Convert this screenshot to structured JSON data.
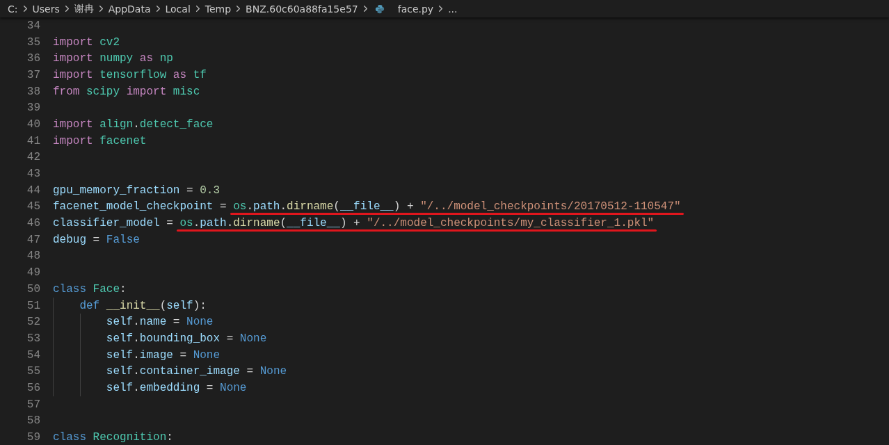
{
  "breadcrumb": [
    {
      "label": "C:",
      "kind": "folder"
    },
    {
      "label": "Users",
      "kind": "folder"
    },
    {
      "label": "谢冉",
      "kind": "folder"
    },
    {
      "label": "AppData",
      "kind": "folder"
    },
    {
      "label": "Local",
      "kind": "folder"
    },
    {
      "label": "Temp",
      "kind": "folder"
    },
    {
      "label": "BNZ.60c60a88fa15e57",
      "kind": "folder"
    },
    {
      "label": "face.py",
      "kind": "python-file"
    },
    {
      "label": "...",
      "kind": "more"
    }
  ],
  "editor": {
    "lines": [
      {
        "number": "34"
      },
      {
        "number": "35",
        "tokens": [
          {
            "text": "import",
            "kind": "keyword"
          },
          {
            "text": " cv2",
            "kind": "module"
          }
        ]
      },
      {
        "number": "36",
        "tokens": [
          {
            "text": "import",
            "kind": "keyword"
          },
          {
            "text": " numpy ",
            "kind": "module"
          },
          {
            "text": "as",
            "kind": "keyword"
          },
          {
            "text": " np",
            "kind": "module"
          }
        ]
      },
      {
        "number": "37",
        "tokens": [
          {
            "text": "import",
            "kind": "keyword"
          },
          {
            "text": " tensorflow ",
            "kind": "module"
          },
          {
            "text": "as",
            "kind": "keyword"
          },
          {
            "text": " tf",
            "kind": "module"
          }
        ]
      },
      {
        "number": "38",
        "tokens": [
          {
            "text": "from",
            "kind": "keyword"
          },
          {
            "text": " scipy ",
            "kind": "module"
          },
          {
            "text": "import",
            "kind": "keyword"
          },
          {
            "text": " misc",
            "kind": "module"
          }
        ]
      },
      {
        "number": "39"
      },
      {
        "number": "40",
        "tokens": [
          {
            "text": "import",
            "kind": "keyword"
          },
          {
            "text": " align",
            "kind": "module"
          },
          {
            "text": ".",
            "kind": "operator"
          },
          {
            "text": "detect_face",
            "kind": "module"
          }
        ]
      },
      {
        "number": "41",
        "tokens": [
          {
            "text": "import",
            "kind": "keyword"
          },
          {
            "text": " facenet",
            "kind": "module"
          }
        ]
      },
      {
        "number": "42"
      },
      {
        "number": "43"
      },
      {
        "number": "44",
        "tokens": [
          {
            "text": "gpu_memory_fraction",
            "kind": "variable"
          },
          {
            "text": " = ",
            "kind": "operator"
          },
          {
            "text": "0.3",
            "kind": "number"
          }
        ]
      },
      {
        "number": "45",
        "tokens": [
          {
            "text": "facenet_model_checkpoint",
            "kind": "variable"
          },
          {
            "text": " = ",
            "kind": "operator"
          }
        ],
        "underlined": [
          {
            "text": "os",
            "kind": "module"
          },
          {
            "text": ".",
            "kind": "operator"
          },
          {
            "text": "path",
            "kind": "variable"
          },
          {
            "text": ".",
            "kind": "operator"
          },
          {
            "text": "dirname",
            "kind": "function"
          },
          {
            "text": "(",
            "kind": "operator"
          },
          {
            "text": "__file__",
            "kind": "variable"
          },
          {
            "text": ") + ",
            "kind": "operator"
          },
          {
            "text": "\"/../model_checkpoints/20170512-110547\"",
            "kind": "string"
          }
        ]
      },
      {
        "number": "46",
        "tokens": [
          {
            "text": "classifier_model",
            "kind": "variable"
          },
          {
            "text": " = ",
            "kind": "operator"
          }
        ],
        "underlined": [
          {
            "text": "os",
            "kind": "module"
          },
          {
            "text": ".",
            "kind": "operator"
          },
          {
            "text": "path",
            "kind": "variable"
          },
          {
            "text": ".",
            "kind": "operator"
          },
          {
            "text": "dirname",
            "kind": "function"
          },
          {
            "text": "(",
            "kind": "operator"
          },
          {
            "text": "__file__",
            "kind": "variable"
          },
          {
            "text": ") + ",
            "kind": "operator"
          },
          {
            "text": "\"/../model_checkpoints/my_classifier_1.pkl\"",
            "kind": "string"
          }
        ]
      },
      {
        "number": "47",
        "tokens": [
          {
            "text": "debug",
            "kind": "variable"
          },
          {
            "text": " = ",
            "kind": "operator"
          },
          {
            "text": "False",
            "kind": "constant"
          }
        ]
      },
      {
        "number": "48"
      },
      {
        "number": "49"
      },
      {
        "number": "50",
        "tokens": [
          {
            "text": "class",
            "kind": "storage"
          },
          {
            "text": " Face",
            "kind": "module"
          },
          {
            "text": ":",
            "kind": "operator"
          }
        ]
      },
      {
        "number": "51",
        "tokens": [
          {
            "text": "    def",
            "kind": "storage"
          },
          {
            "text": " __init__",
            "kind": "function"
          },
          {
            "text": "(",
            "kind": "operator"
          },
          {
            "text": "self",
            "kind": "variable"
          },
          {
            "text": "):",
            "kind": "operator"
          }
        ]
      },
      {
        "number": "52",
        "tokens": [
          {
            "text": "        self",
            "kind": "variable"
          },
          {
            "text": ".",
            "kind": "operator"
          },
          {
            "text": "name",
            "kind": "variable"
          },
          {
            "text": " = ",
            "kind": "operator"
          },
          {
            "text": "None",
            "kind": "constant"
          }
        ]
      },
      {
        "number": "53",
        "tokens": [
          {
            "text": "        self",
            "kind": "variable"
          },
          {
            "text": ".",
            "kind": "operator"
          },
          {
            "text": "bounding_box",
            "kind": "variable"
          },
          {
            "text": " = ",
            "kind": "operator"
          },
          {
            "text": "None",
            "kind": "constant"
          }
        ]
      },
      {
        "number": "54",
        "tokens": [
          {
            "text": "        self",
            "kind": "variable"
          },
          {
            "text": ".",
            "kind": "operator"
          },
          {
            "text": "image",
            "kind": "variable"
          },
          {
            "text": " = ",
            "kind": "operator"
          },
          {
            "text": "None",
            "kind": "constant"
          }
        ]
      },
      {
        "number": "55",
        "tokens": [
          {
            "text": "        self",
            "kind": "variable"
          },
          {
            "text": ".",
            "kind": "operator"
          },
          {
            "text": "container_image",
            "kind": "variable"
          },
          {
            "text": " = ",
            "kind": "operator"
          },
          {
            "text": "None",
            "kind": "constant"
          }
        ]
      },
      {
        "number": "56",
        "tokens": [
          {
            "text": "        self",
            "kind": "variable"
          },
          {
            "text": ".",
            "kind": "operator"
          },
          {
            "text": "embedding",
            "kind": "variable"
          },
          {
            "text": " = ",
            "kind": "operator"
          },
          {
            "text": "None",
            "kind": "constant"
          }
        ]
      },
      {
        "number": "57"
      },
      {
        "number": "58"
      },
      {
        "number": "59",
        "tokens": [
          {
            "text": "class",
            "kind": "storage"
          },
          {
            "text": " Recognition",
            "kind": "module"
          },
          {
            "text": ":",
            "kind": "operator"
          }
        ]
      }
    ]
  }
}
